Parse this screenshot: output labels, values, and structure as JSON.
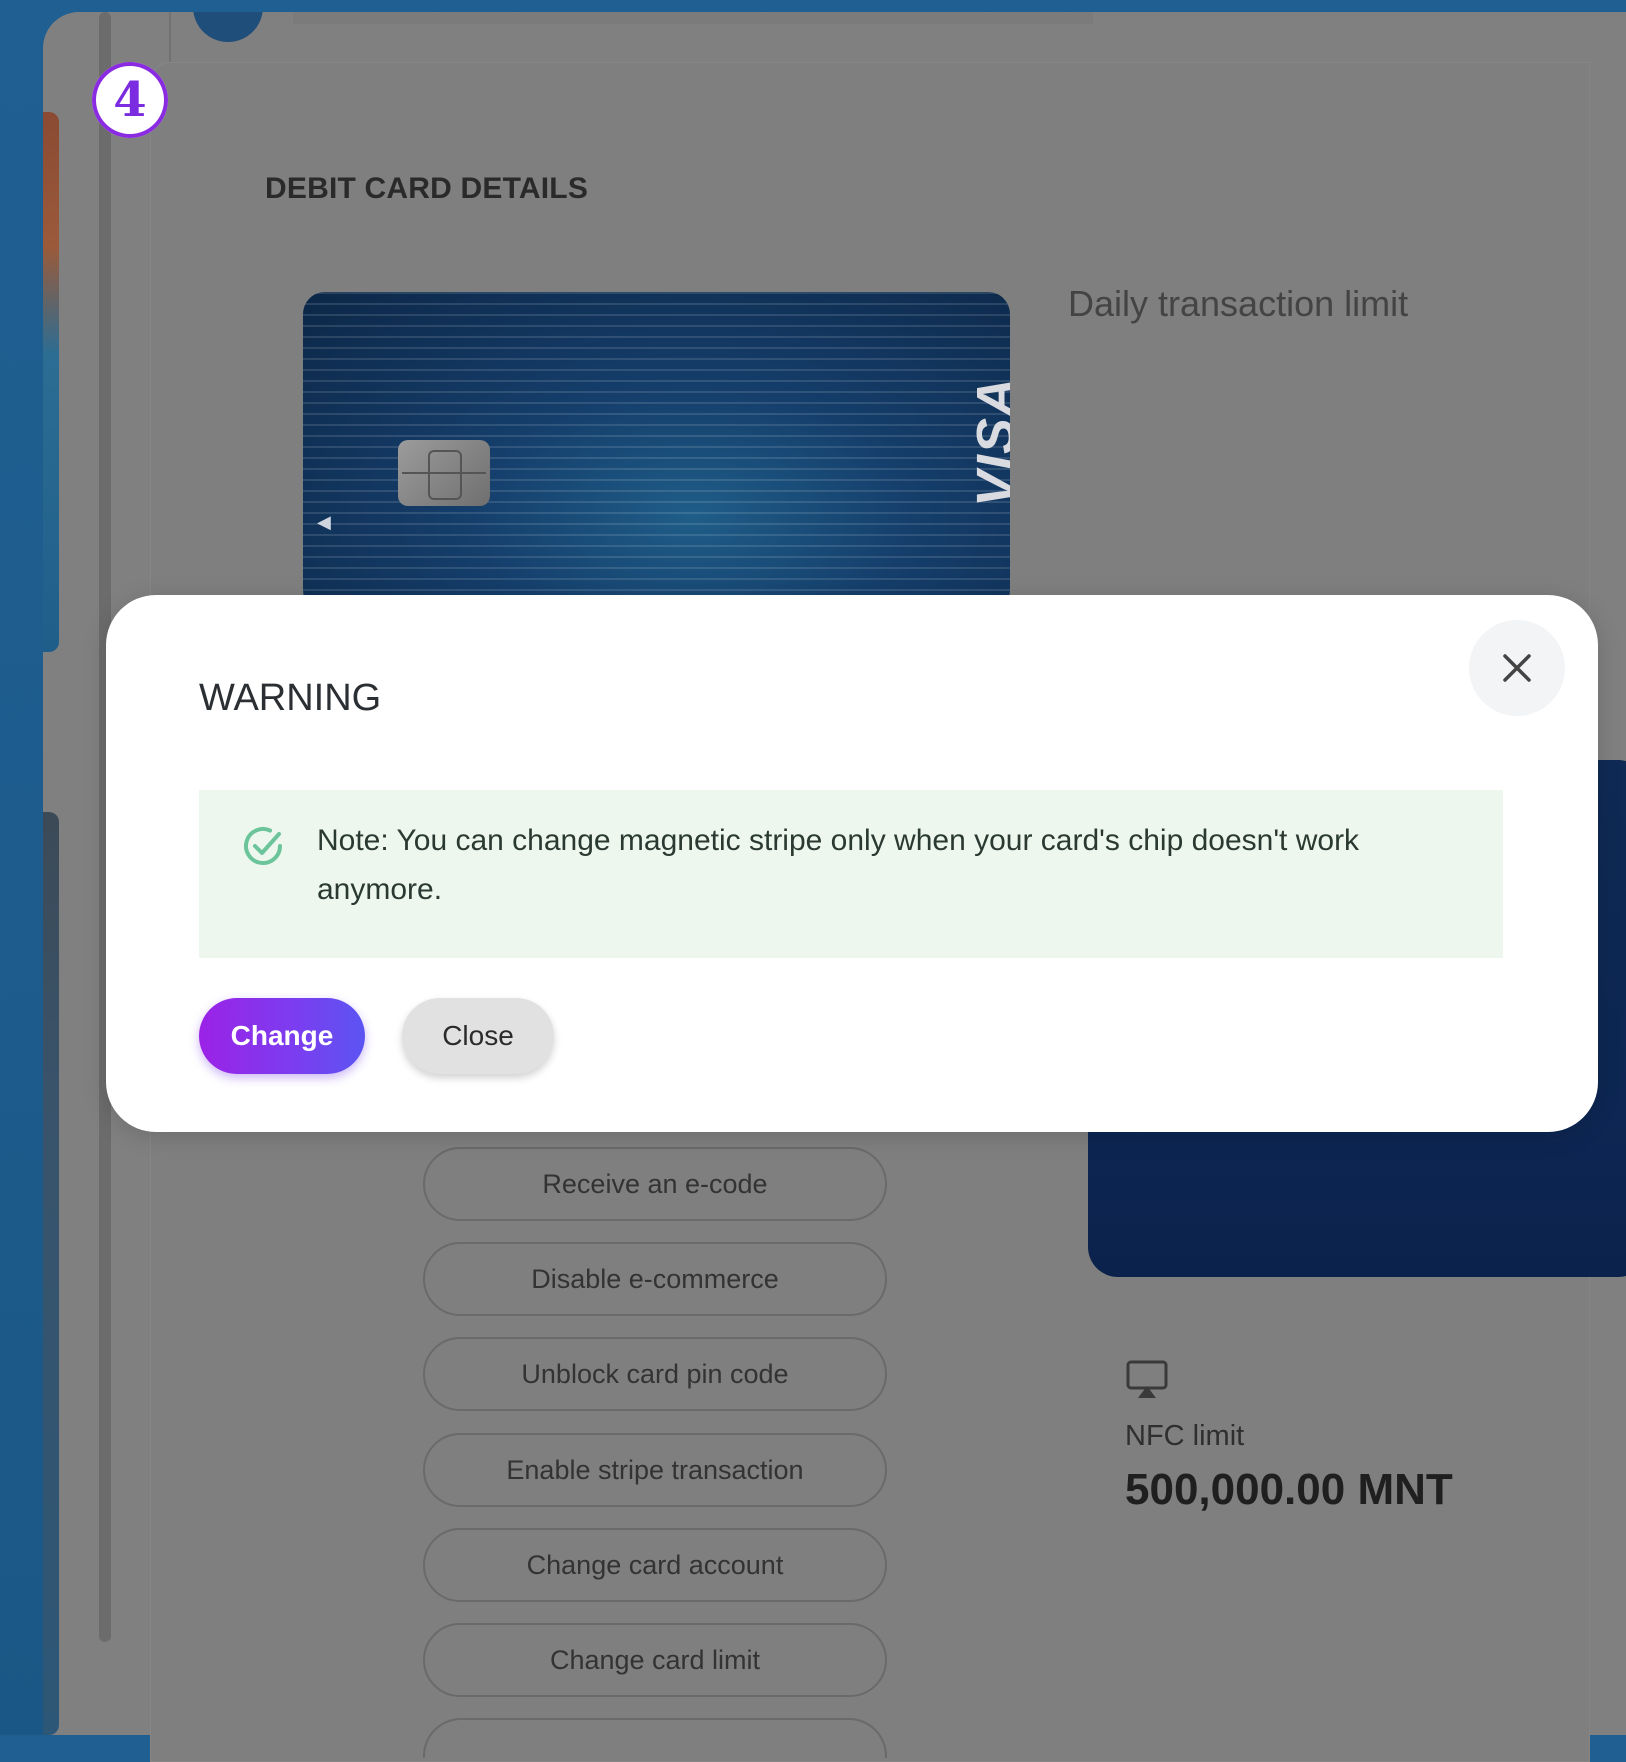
{
  "step_badge": "4",
  "page": {
    "section_title": "DEBIT CARD DETAILS",
    "daily_limit_label": "Daily transaction limit"
  },
  "card": {
    "brand": "VISA",
    "icons": [
      "chip-icon",
      "visa-logo",
      "chevron-left-icon"
    ]
  },
  "actions": [
    "Receive an e-code",
    "Disable e-commerce",
    "Unblock card pin code",
    "Enable stripe transaction",
    "Change card account",
    "Change card limit"
  ],
  "nfc": {
    "icon": "airplay-icon",
    "label": "NFC limit",
    "value": "500,000.00 MNT"
  },
  "modal": {
    "title": "WARNING",
    "note": "Note: You can change magnetic stripe only when your card's chip doesn't work anymore.",
    "note_icon": "check-circle-icon",
    "change_label": "Change",
    "close_label": "Close",
    "close_icon": "close-icon"
  },
  "colors": {
    "accent_gradient_start": "#9b22e6",
    "accent_gradient_end": "#5b55f2",
    "badge_ring": "#8a2be2",
    "note_bg": "#eef7ee",
    "note_icon": "#6cc49a",
    "backdrop": "#1d5c8d"
  }
}
